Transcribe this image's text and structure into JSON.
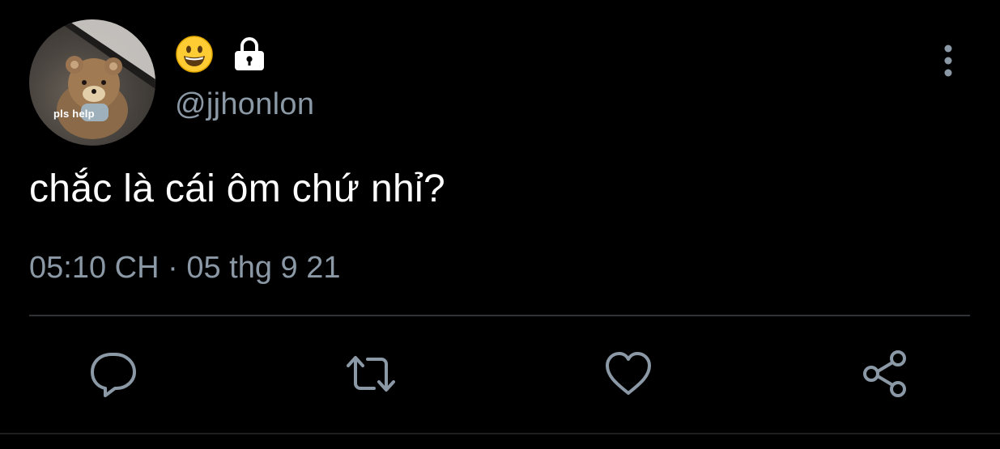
{
  "tweet": {
    "author": {
      "avatar_caption": "pls help",
      "display_name_icons": [
        "grinning-face-emoji",
        "lock-icon"
      ],
      "handle": "@jjhonlon"
    },
    "text": "chắc là cái ôm chứ nhỉ?",
    "time": "05:10 CH",
    "separator": "·",
    "date": "05 thg 9 21"
  },
  "actions": [
    {
      "name": "reply",
      "icon": "comment-icon"
    },
    {
      "name": "retweet",
      "icon": "retweet-icon"
    },
    {
      "name": "like",
      "icon": "heart-icon"
    },
    {
      "name": "share",
      "icon": "share-icon"
    }
  ],
  "colors": {
    "background": "#000000",
    "text_primary": "#ffffff",
    "text_secondary": "#8b98a5",
    "icon": "#8b98a5",
    "divider": "#2f3336"
  }
}
